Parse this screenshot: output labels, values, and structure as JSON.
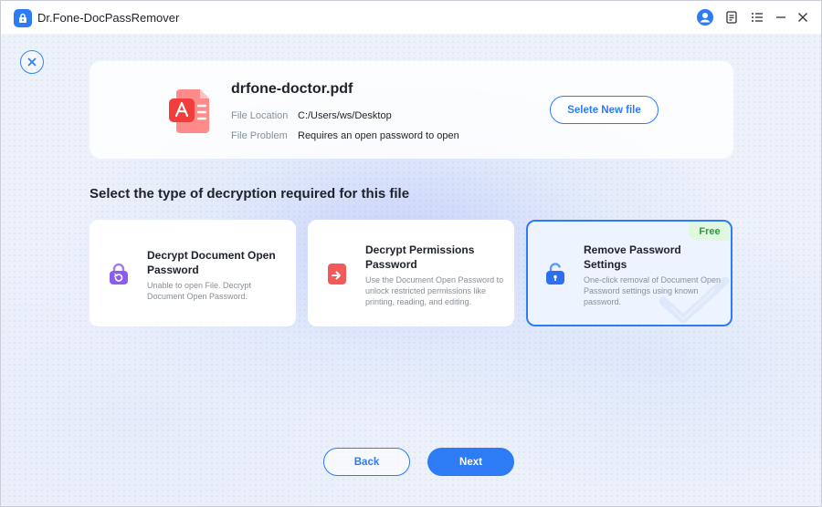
{
  "window": {
    "title": "Dr.Fone-DocPassRemover",
    "accent_color": "#2e7bf6"
  },
  "titlebar_icons": [
    "user-icon",
    "notes-icon",
    "menu-icon",
    "minimize-icon",
    "close-icon"
  ],
  "file": {
    "name": "drfone-doctor.pdf",
    "location_label": "File Location",
    "location_value": "C:/Users/ws/Desktop",
    "problem_label": "File Problem",
    "problem_value": "Requires an open password to open",
    "select_new_button": "Selete New file"
  },
  "section_title": "Select the type of decryption required for this file",
  "options": [
    {
      "title": "Decrypt Document Open Password",
      "description": "Unable to open File. Decrypt Document Open Password.",
      "icon": "purple-lock-icon",
      "selected": false
    },
    {
      "title": "Decrypt Permissions Password",
      "description": "Use the Document Open Password to unlock restricted permissions like printing, reading, and editing.",
      "icon": "red-unlock-file-icon",
      "selected": false
    },
    {
      "title": "Remove Password Settings",
      "description": "One-click removal of Document Open Password settings using known password.",
      "icon": "blue-unlock-icon",
      "badge": "Free",
      "selected": true
    }
  ],
  "footer": {
    "back_label": "Back",
    "next_label": "Next"
  }
}
